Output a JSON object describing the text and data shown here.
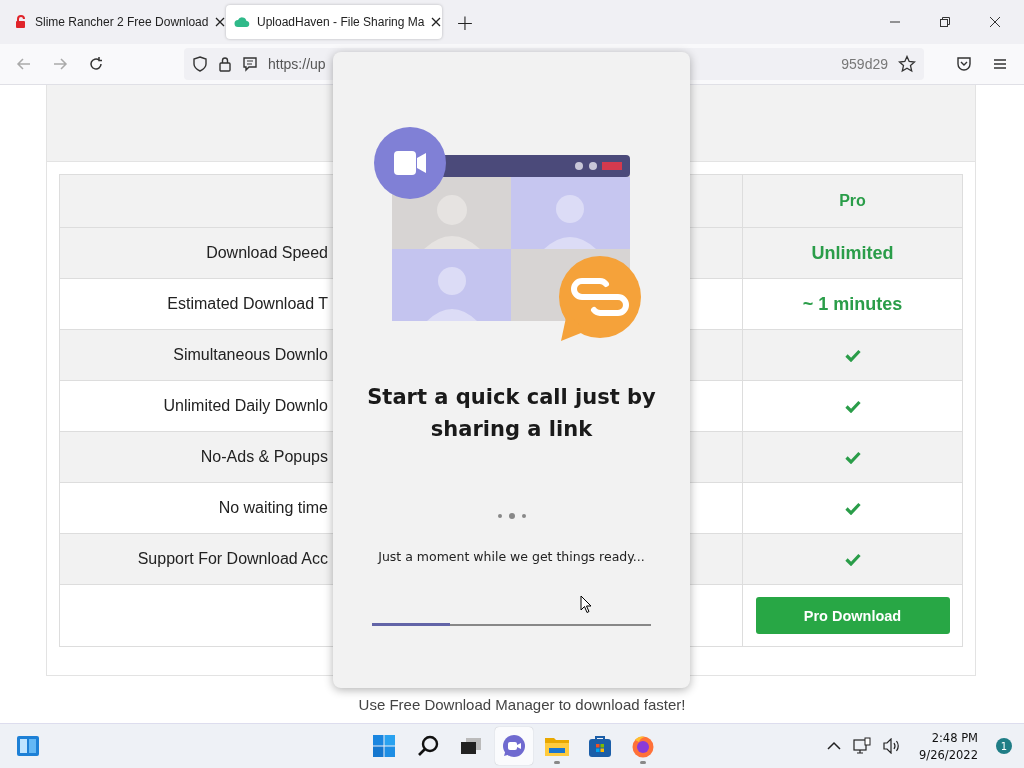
{
  "browser": {
    "tabs": [
      {
        "title": "Slime Rancher 2 Free Download",
        "selected": false,
        "kind": "lock"
      },
      {
        "title": "UploadHaven - File Sharing Ma",
        "selected": true,
        "kind": "cloud"
      }
    ],
    "new_tab": "+",
    "url_start": "https://up",
    "url_end": "959d29"
  },
  "page": {
    "pro_header": "Pro",
    "rows": [
      {
        "feature": "Download Speed",
        "kind": "text",
        "pro": "Unlimited"
      },
      {
        "feature": "Estimated Download T",
        "kind": "text",
        "pro": "~ 1 minutes"
      },
      {
        "feature": "Simultaneous Downlo",
        "kind": "check"
      },
      {
        "feature": "Unlimited Daily Downlo",
        "kind": "check"
      },
      {
        "feature": "No-Ads & Popups",
        "kind": "check"
      },
      {
        "feature": "No waiting time",
        "kind": "check"
      },
      {
        "feature": "Support For Download Acc",
        "kind": "check"
      }
    ],
    "button": "Pro Download",
    "footer_hint": "Use Free Download Manager to download faster!"
  },
  "dialog": {
    "title": "Start a quick call just by sharing a link",
    "message": "Just a moment while we get things ready...",
    "progress": {
      "level": 0.28
    }
  },
  "taskbar": {
    "apps": [
      {
        "kind": "search",
        "running": false,
        "selected": false
      },
      {
        "kind": "taskview",
        "running": false,
        "selected": false
      },
      {
        "kind": "chat",
        "running": false,
        "selected": true
      },
      {
        "kind": "folder",
        "running": true,
        "selected": false
      },
      {
        "kind": "store",
        "running": false,
        "selected": false
      },
      {
        "kind": "firefox",
        "running": true,
        "selected": false
      }
    ],
    "time": "2:48 PM",
    "date": "9/26/2022",
    "notifications": "1"
  }
}
